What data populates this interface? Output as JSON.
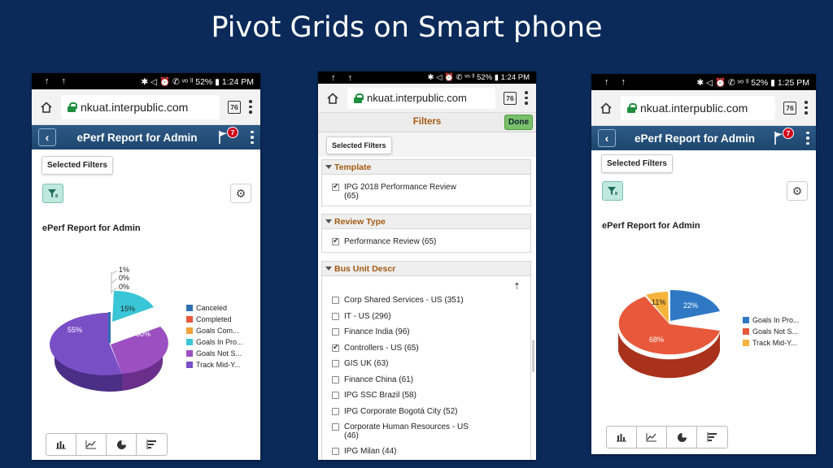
{
  "slide_title": "Pivot Grids on Smart phone",
  "phones": [
    {
      "status": {
        "icons_left": "↑ ↑",
        "icons_right": "✱ ◁ ⏰ ✆ ᵛᵒ ˡˡ",
        "battery": "52%",
        "time": "1:24 PM"
      },
      "url": "nkuat.interpublic.com",
      "tab_count": "76",
      "app_title": "ePerf Report for Admin",
      "badge": "7",
      "selected_filters": "Selected Filters",
      "report_title": "ePerf Report for Admin",
      "slice_labels": {
        "canceled": "1%",
        "completed": "0%",
        "goals_com": "0%",
        "goals_in": "15%",
        "goals_not": "30%",
        "track": "55%"
      },
      "legend": [
        "Canceled",
        "Completed",
        "Goals Com...",
        "Goals In Pro...",
        "Goals Not S...",
        "Track Mid-Y..."
      ]
    },
    {
      "status": {
        "icons_left": "↑ ↑",
        "icons_right": "✱ ◁ ⏰ ✆ ᵛᵒ ˡˡ",
        "battery": "52%",
        "time": "1:24 PM"
      },
      "url": "nkuat.interpublic.com",
      "tab_count": "76",
      "filters_title": "Filters",
      "done": "Done",
      "selected_filters": "Selected Filters",
      "groups": [
        {
          "title": "Template",
          "items": [
            {
              "label": "IPG 2018 Performance Review (65)",
              "checked": true
            }
          ]
        },
        {
          "title": "Review Type",
          "items": [
            {
              "label": "Performance Review (65)",
              "checked": true
            }
          ]
        },
        {
          "title": "Bus Unit Descr",
          "items": [
            {
              "label": "Corp Shared Services - US (351)",
              "checked": false
            },
            {
              "label": "IT - US (296)",
              "checked": false
            },
            {
              "label": "Finance India (96)",
              "checked": false
            },
            {
              "label": "Controllers - US (65)",
              "checked": true
            },
            {
              "label": "GIS UK (63)",
              "checked": false
            },
            {
              "label": "Finance China (61)",
              "checked": false
            },
            {
              "label": "IPG SSC Brazil (58)",
              "checked": false
            },
            {
              "label": "IPG Corporate Bogotá City (52)",
              "checked": false
            },
            {
              "label": "Corporate Human Resources - US (46)",
              "checked": false
            },
            {
              "label": "IPG Milan (44)",
              "checked": false
            }
          ]
        }
      ]
    },
    {
      "status": {
        "icons_left": "↑ ↑",
        "icons_right": "✱ ◁ ⏰ ✆ ᵛᵒ ˡˡ",
        "battery": "52%",
        "time": "1:25 PM"
      },
      "url": "nkuat.interpublic.com",
      "tab_count": "76",
      "app_title": "ePerf Report for Admin",
      "badge": "7",
      "selected_filters": "Selected Filters",
      "report_title": "ePerf Report for Admin",
      "slice_labels": {
        "goals_in": "22%",
        "goals_not": "68%",
        "track": "11%"
      },
      "legend": [
        "Goals In Pro...",
        "Goals Not S...",
        "Track Mid-Y..."
      ]
    }
  ],
  "colors": {
    "canceled": "#2f6fb0",
    "completed": "#e8583a",
    "goals_com": "#f2a33a",
    "goals_in": "#39c6d6",
    "goals_not": "#9b4fc0",
    "track": "#7a4fc6",
    "p3_goals_in": "#2f78c4",
    "p3_goals_not": "#e8583a",
    "p3_track": "#f6b43c"
  },
  "icons": [
    "home-icon",
    "lock-icon",
    "kebab-icon",
    "back-icon",
    "flag-icon",
    "filter-icon",
    "gear-icon",
    "bar-chart-icon",
    "line-chart-icon",
    "pie-chart-icon",
    "horizontal-bar-icon",
    "sort-icon"
  ]
}
